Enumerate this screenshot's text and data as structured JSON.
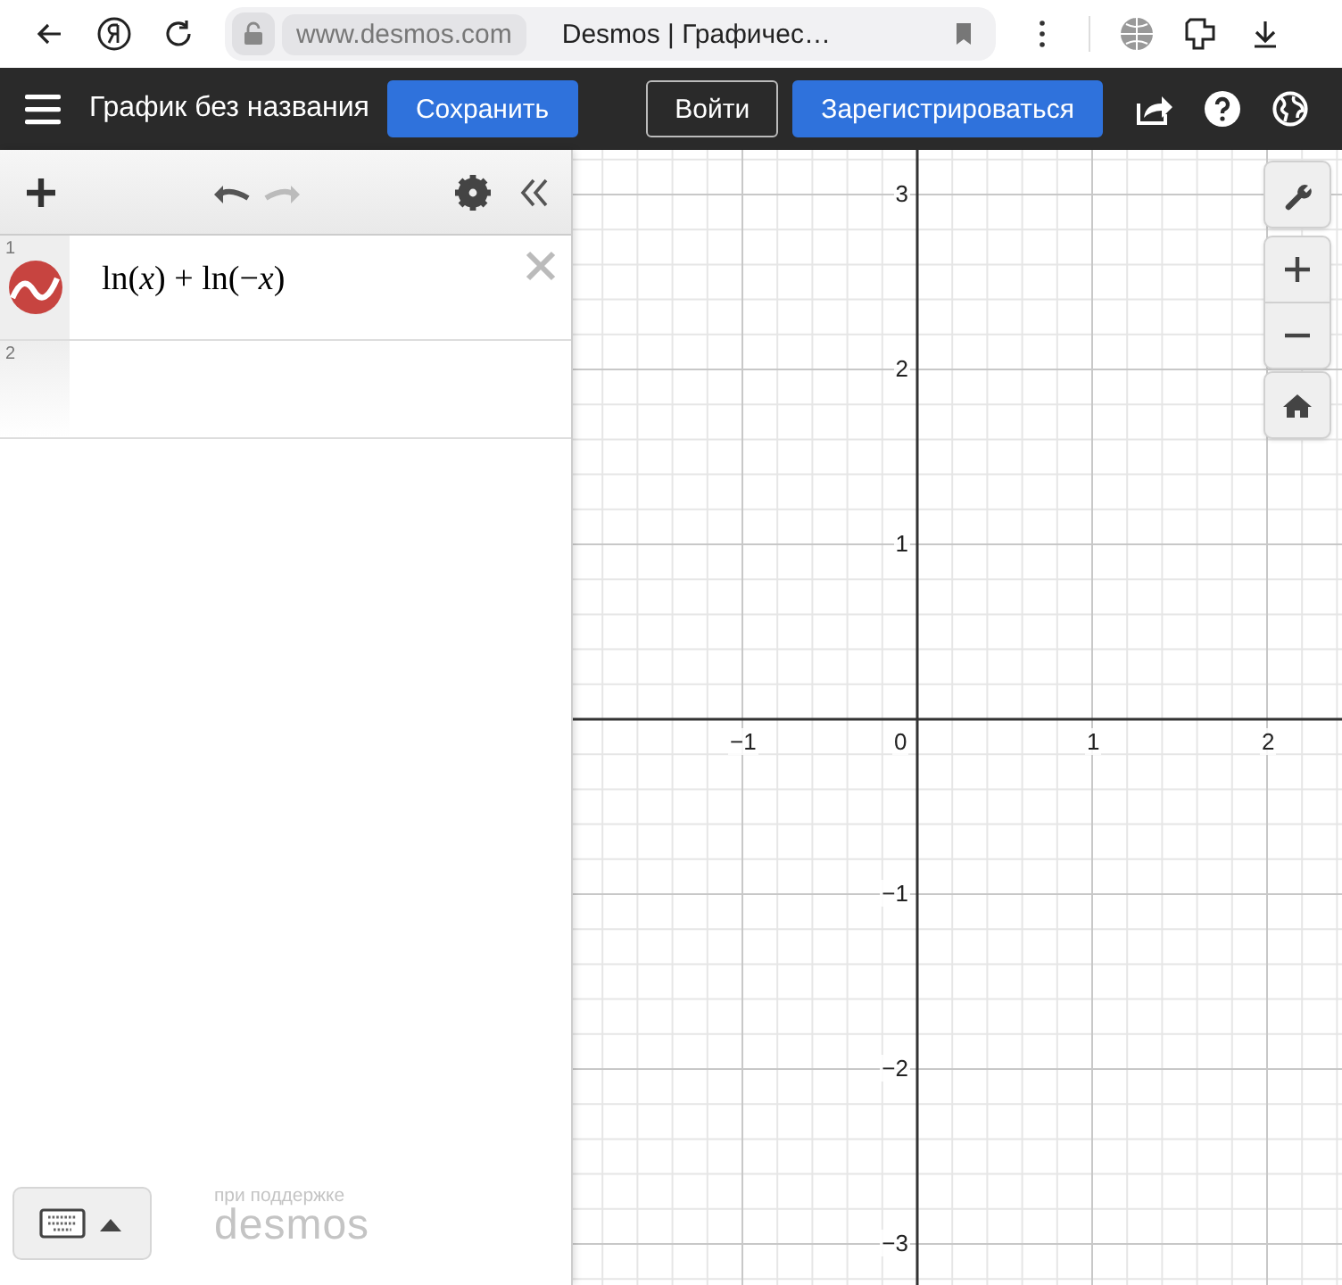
{
  "browser": {
    "address": "www.desmos.com",
    "tab_title": "Desmos | Графичес…"
  },
  "header": {
    "title": "График без названия",
    "save": "Сохранить",
    "login": "Войти",
    "signup": "Зарегистрироваться"
  },
  "expressions": [
    {
      "index": "1",
      "latex": "ln(*x*) + ln(−*x*)",
      "color": "#c74440"
    },
    {
      "index": "2"
    }
  ],
  "footer": {
    "powered_by": "при поддержке",
    "brand": "desmos"
  },
  "graph": {
    "x_labels": [
      "−1",
      "0",
      "1",
      "2"
    ],
    "y_labels": [
      "3",
      "2",
      "1",
      "−1",
      "−2",
      "−3"
    ]
  }
}
